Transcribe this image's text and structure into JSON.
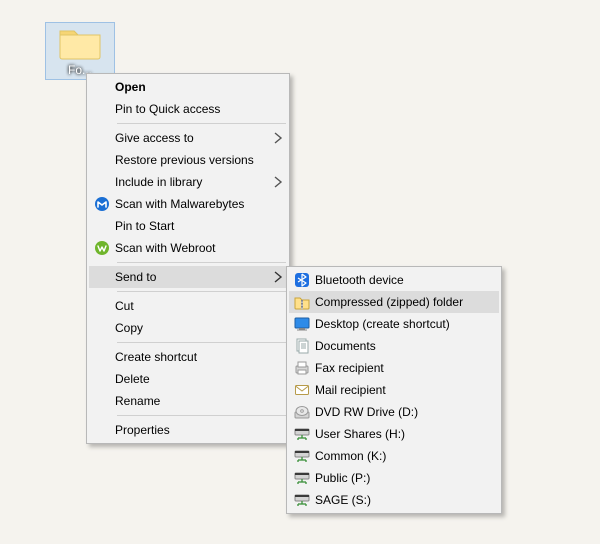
{
  "desktop": {
    "folder_label": "Fo..."
  },
  "context_menu": {
    "open": "Open",
    "pin_quick_access": "Pin to Quick access",
    "give_access_to": "Give access to",
    "restore_previous": "Restore previous versions",
    "include_in_library": "Include in library",
    "scan_malwarebytes": "Scan with Malwarebytes",
    "pin_to_start": "Pin to Start",
    "scan_webroot": "Scan with Webroot",
    "send_to": "Send to",
    "cut": "Cut",
    "copy": "Copy",
    "create_shortcut": "Create shortcut",
    "delete": "Delete",
    "rename": "Rename",
    "properties": "Properties"
  },
  "send_to_menu": {
    "bluetooth": "Bluetooth device",
    "compressed": "Compressed (zipped) folder",
    "desktop_shortcut": "Desktop (create shortcut)",
    "documents": "Documents",
    "fax": "Fax recipient",
    "mail": "Mail recipient",
    "dvd_rw": "DVD RW Drive (D:)",
    "user_shares": "User Shares (H:)",
    "common": "Common (K:)",
    "public": "Public (P:)",
    "sage": "SAGE (S:)"
  }
}
